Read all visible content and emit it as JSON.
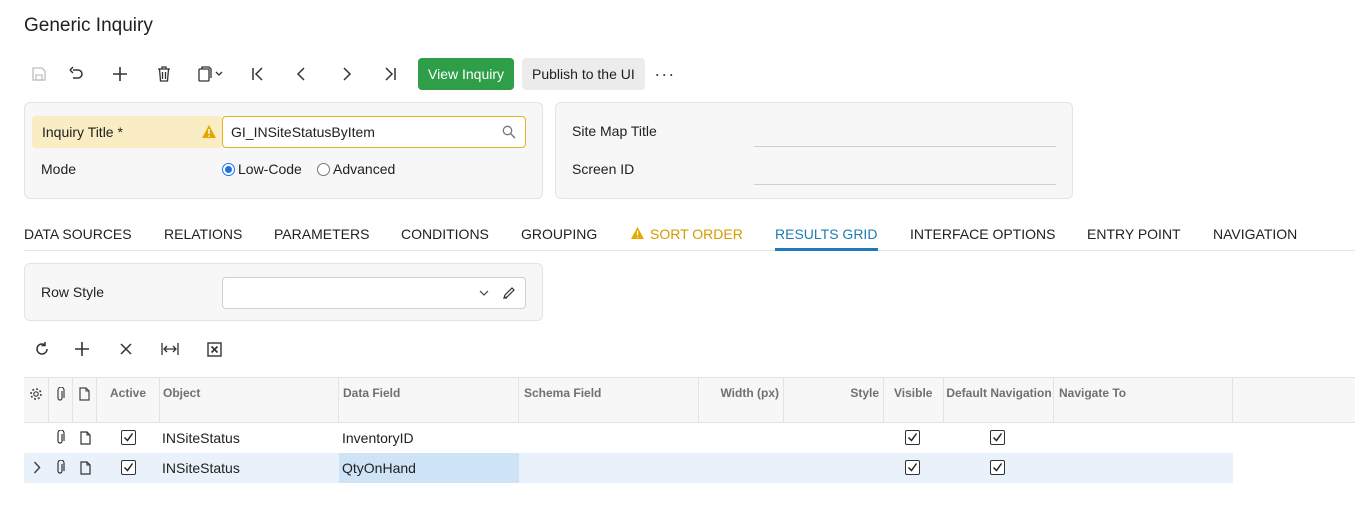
{
  "page": {
    "title": "Generic Inquiry"
  },
  "toolbar": {
    "save_icon": "save-icon",
    "undo_icon": "undo-icon",
    "add_icon": "plus-icon",
    "delete_icon": "trash-icon",
    "copy_paste_icon": "clipboard-icon",
    "first_icon": "first-record-icon",
    "prev_icon": "previous-icon",
    "next_icon": "next-icon",
    "last_icon": "last-record-icon",
    "view_inquiry_label": "View Inquiry",
    "publish_label": "Publish to the UI",
    "more_label": "···"
  },
  "form": {
    "inquiry_title_label": "Inquiry Title *",
    "inquiry_title_value": "GI_INSiteStatusByItem",
    "mode_label": "Mode",
    "mode_options": [
      "Low-Code",
      "Advanced"
    ],
    "mode_selected": "Low-Code",
    "site_map_title_label": "Site Map Title",
    "site_map_title_value": "",
    "screen_id_label": "Screen ID",
    "screen_id_value": ""
  },
  "tabs": [
    {
      "label": "DATA SOURCES"
    },
    {
      "label": "RELATIONS"
    },
    {
      "label": "PARAMETERS"
    },
    {
      "label": "CONDITIONS"
    },
    {
      "label": "GROUPING"
    },
    {
      "label": "SORT ORDER",
      "warning": true
    },
    {
      "label": "RESULTS GRID",
      "active": true
    },
    {
      "label": "INTERFACE OPTIONS"
    },
    {
      "label": "ENTRY POINT"
    },
    {
      "label": "NAVIGATION"
    }
  ],
  "row_style": {
    "label": "Row Style",
    "value": ""
  },
  "grid": {
    "columns": [
      "Active",
      "Object",
      "Data Field",
      "Schema Field",
      "Width (px)",
      "Style",
      "Visible",
      "Default Navigation",
      "Navigate To"
    ],
    "rows": [
      {
        "active": true,
        "object": "INSiteStatus",
        "data_field": "InventoryID",
        "schema_field": "",
        "width": "",
        "style": "",
        "visible": true,
        "default_navigation": true,
        "navigate_to": ""
      },
      {
        "active": true,
        "object": "INSiteStatus",
        "data_field": "QtyOnHand",
        "schema_field": "",
        "width": "",
        "style": "",
        "visible": true,
        "default_navigation": true,
        "navigate_to": "",
        "selected": true
      }
    ]
  },
  "colors": {
    "accent": "#1f7bb8",
    "primary_button": "#2e9e48",
    "warning": "#d39a00",
    "required_bg": "#faedc4"
  }
}
